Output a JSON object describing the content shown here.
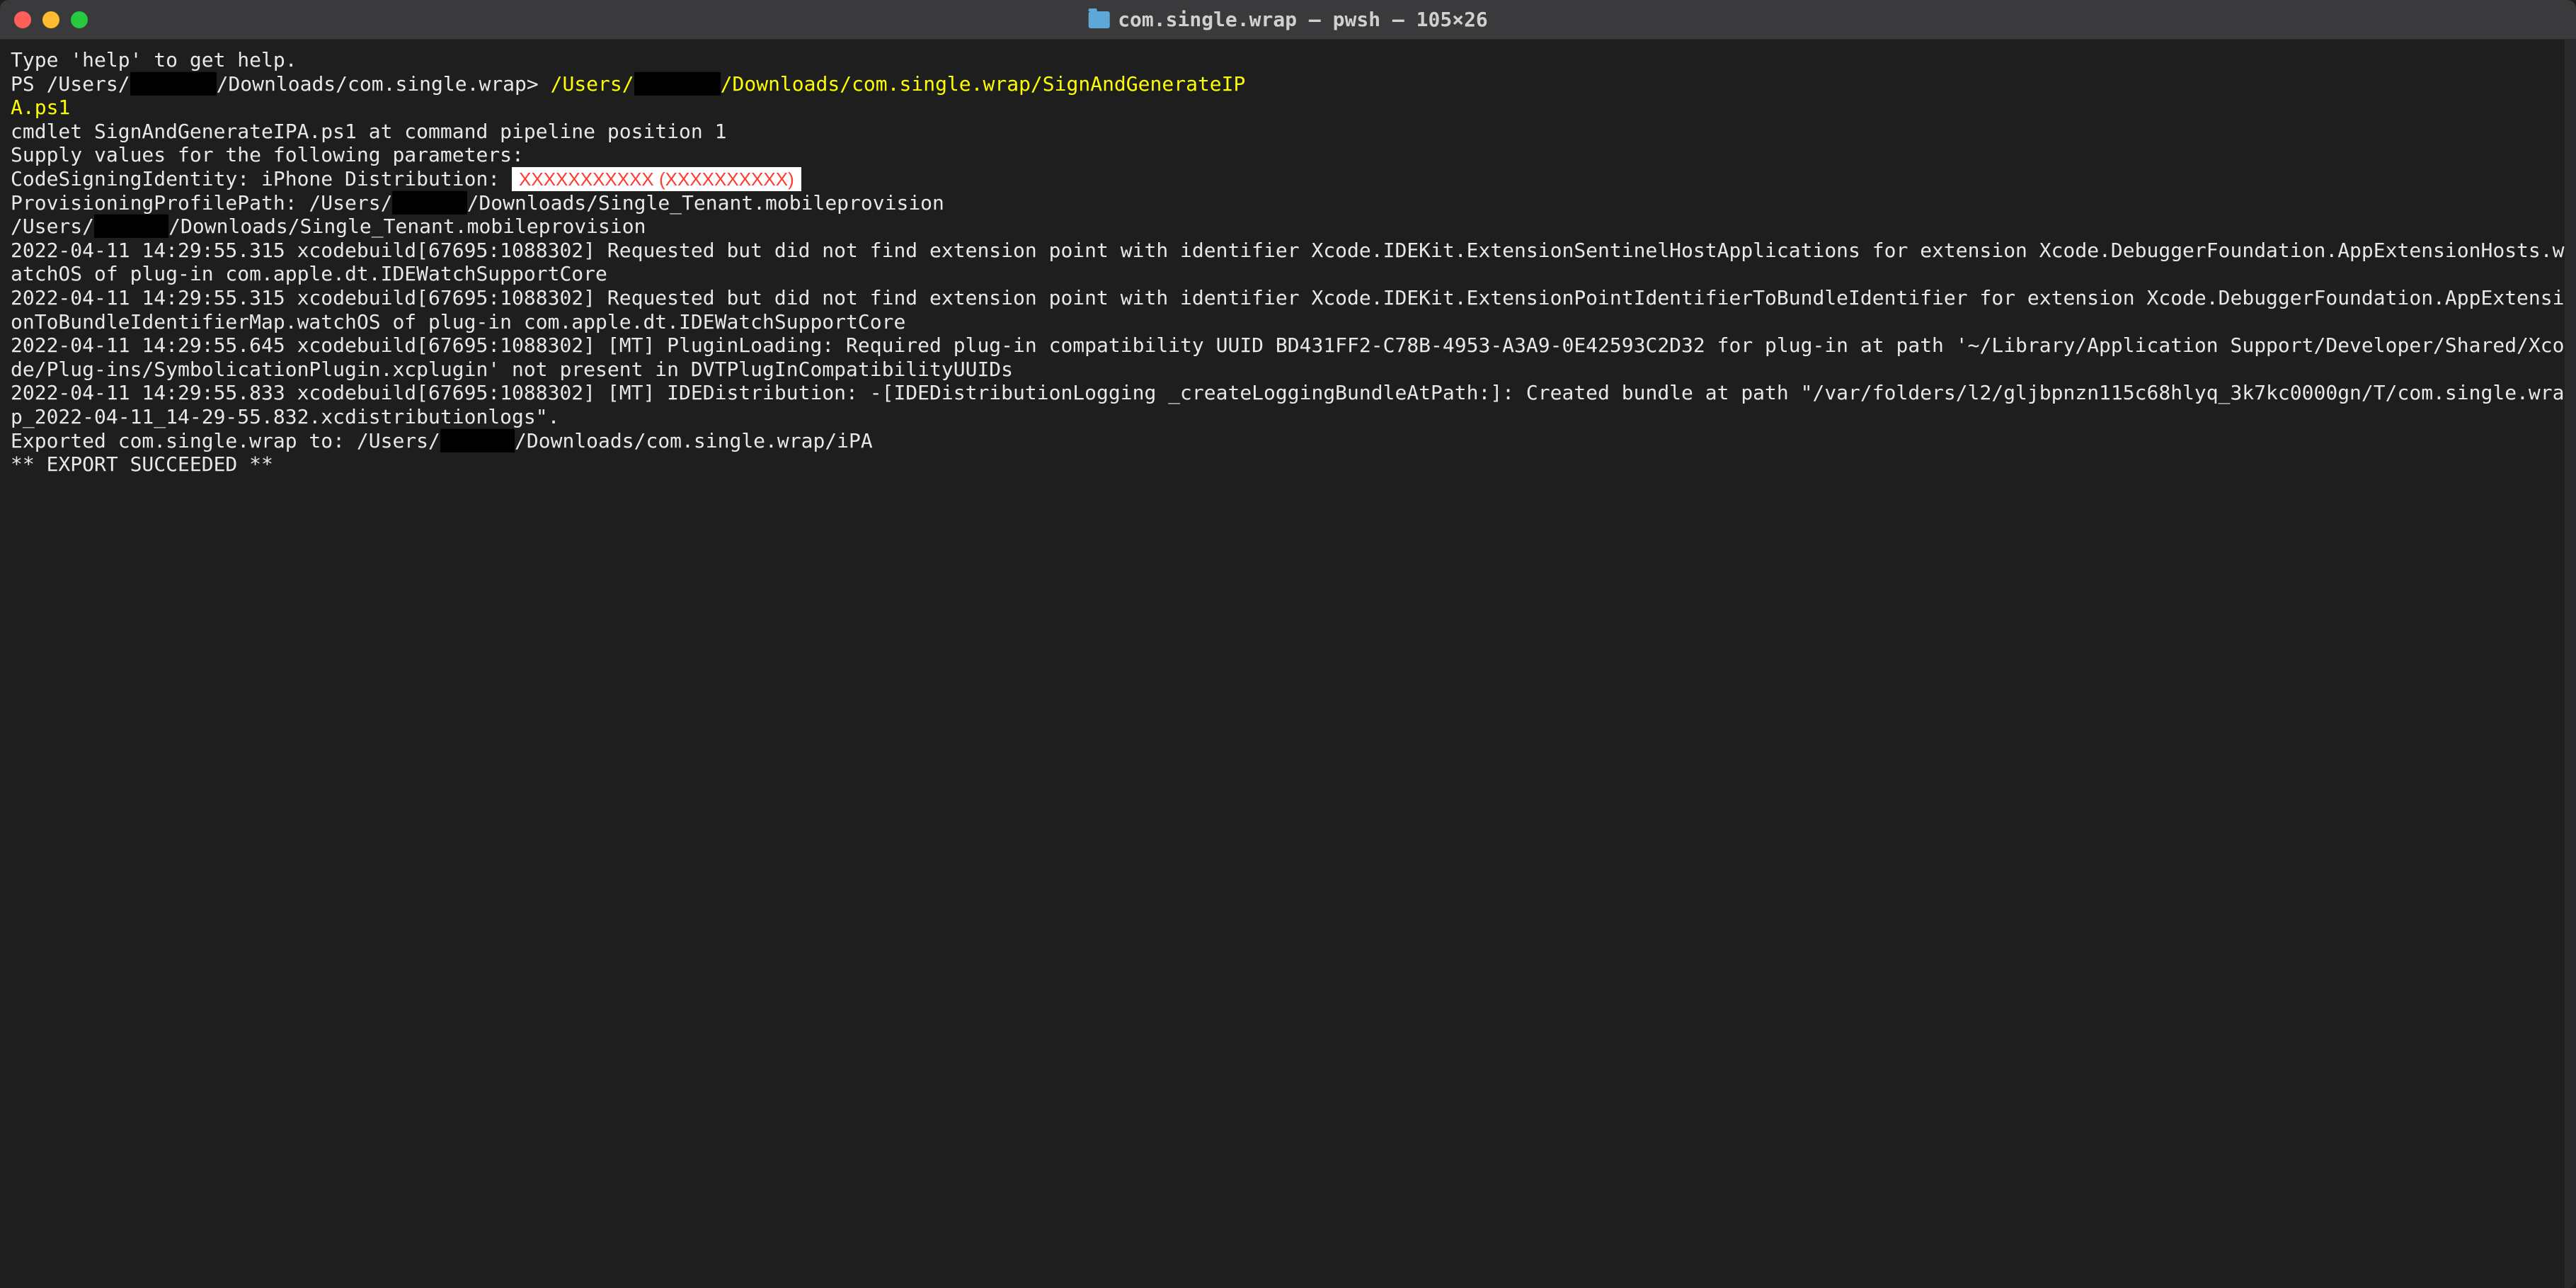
{
  "window": {
    "title": "com.single.wrap — pwsh — 105×26"
  },
  "terminal": {
    "l1": "Type 'help' to get help.",
    "l2": "",
    "prompt_prefix": "PS /Users/",
    "prompt_redacted": "███████",
    "prompt_suffix": "/Downloads/com.single.wrap> ",
    "cmd_prefix": "/Users/",
    "cmd_redacted": "███████",
    "cmd_suffix": "/Downloads/com.single.wrap/SignAndGenerateIP",
    "cmd_cont": "A.ps1",
    "l5_blank": "",
    "l6": "cmdlet SignAndGenerateIPA.ps1 at command pipeline position 1",
    "l7": "Supply values for the following parameters:",
    "l8_prefix": "CodeSigningIdentity: iPhone Distribution: ",
    "l8_redacted": "XXXXXXXXXXX (XXXXXXXXXX)",
    "l9_prefix": "ProvisioningProfilePath: /Users/",
    "l9_redacted": "██████",
    "l9_suffix": "/Downloads/Single_Tenant.mobileprovision",
    "l10_prefix": "/Users/",
    "l10_redacted": "██████",
    "l10_suffix": "/Downloads/Single_Tenant.mobileprovision",
    "l11": "2022-04-11 14:29:55.315 xcodebuild[67695:1088302] Requested but did not find extension point with identifier Xcode.IDEKit.ExtensionSentinelHostApplications for extension Xcode.DebuggerFoundation.AppExtensionHosts.watchOS of plug-in com.apple.dt.IDEWatchSupportCore",
    "l12": "2022-04-11 14:29:55.315 xcodebuild[67695:1088302] Requested but did not find extension point with identifier Xcode.IDEKit.ExtensionPointIdentifierToBundleIdentifier for extension Xcode.DebuggerFoundation.AppExtensionToBundleIdentifierMap.watchOS of plug-in com.apple.dt.IDEWatchSupportCore",
    "l13": "2022-04-11 14:29:55.645 xcodebuild[67695:1088302] [MT] PluginLoading: Required plug-in compatibility UUID BD431FF2-C78B-4953-A3A9-0E42593C2D32 for plug-in at path '~/Library/Application Support/Developer/Shared/Xcode/Plug-ins/SymbolicationPlugin.xcplugin' not present in DVTPlugInCompatibilityUUIDs",
    "l14": "2022-04-11 14:29:55.833 xcodebuild[67695:1088302] [MT] IDEDistribution: -[IDEDistributionLogging _createLoggingBundleAtPath:]: Created bundle at path \"/var/folders/l2/gljbpnzn115c68hlyq_3k7kc0000gn/T/com.single.wrap_2022-04-11_14-29-55.832.xcdistributionlogs\".",
    "l15_prefix": "Exported com.single.wrap to: /Users/",
    "l15_redacted": "██████",
    "l15_suffix": "/Downloads/com.single.wrap/iPA",
    "l16": "** EXPORT SUCCEEDED **"
  }
}
